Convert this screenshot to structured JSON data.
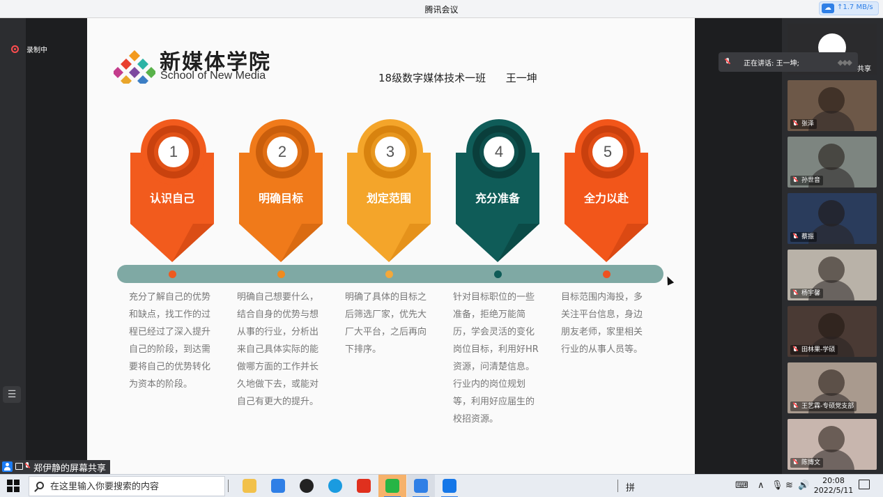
{
  "window": {
    "title": "腾讯会议",
    "net_rate": "↑1.7 MB/s"
  },
  "recording": {
    "label": "录制中"
  },
  "slide": {
    "brand_cn": "新媒体学院",
    "brand_en": "School of New Media",
    "student": "18级数字媒体技术一班      王一坤",
    "steps": [
      {
        "num": "1",
        "label": "认识自己",
        "color": "#f25b1d",
        "dark": "#c9420e",
        "desc": "充分了解自己的优势和缺点，找工作的过程已经过了深入提升自己的阶段，到达需要将自己的优势转化为资本的阶段。"
      },
      {
        "num": "2",
        "label": "明确目标",
        "color": "#f07a1a",
        "dark": "#c95e0c",
        "desc": "明确自己想要什么，结合自身的优势与想从事的行业，分析出来自己具体实际的能做哪方面的工作并长久地做下去，或能对自己有更大的提升。"
      },
      {
        "num": "3",
        "label": "划定范围",
        "color": "#f4a52a",
        "dark": "#d8830f",
        "desc": "明确了具体的目标之后筛选厂家，优先大厂大平台，之后再向下排序。"
      },
      {
        "num": "4",
        "label": "充分准备",
        "color": "#0f5c58",
        "dark": "#0a3e3b",
        "desc": "针对目标职位的一些准备，拒绝万能简历，学会灵活的变化岗位目标，利用好HR资源，问清楚信息。\n行业内的岗位规划等，利用好应届生的校招资源。"
      },
      {
        "num": "5",
        "label": "全力以赴",
        "color": "#f2561a",
        "dark": "#c9400e",
        "desc": "目标范围内海投，多关注平台信息，身边朋友老师，家里相关行业的从事人员等。"
      }
    ],
    "dot_colors": [
      "#ee5a1f",
      "#f08a1e",
      "#f4a83a",
      "#0f5c58",
      "#ee5121"
    ]
  },
  "speaking": {
    "text": "正在讲话: 王一坤;",
    "share_suffix": "共享"
  },
  "participants": [
    {
      "name": "",
      "bg": "#2b2b2d"
    },
    {
      "name": "张泽",
      "bg": "#6d5848"
    },
    {
      "name": "孙世音",
      "bg": "#7d8580"
    },
    {
      "name": "蔡振",
      "bg": "#2a3c5c"
    },
    {
      "name": "杨宇馨",
      "bg": "#b9b2a8"
    },
    {
      "name": "田林果-学硕",
      "bg": "#4a3a34"
    },
    {
      "name": "王艺霖-专硕党支部",
      "bg": "#a99a8e"
    },
    {
      "name": "陈博文",
      "bg": "#c8b6ae"
    }
  ],
  "sharer": {
    "label": "郑伊静的屏幕共享"
  },
  "taskbar": {
    "search_placeholder": "在这里输入你要搜索的内容",
    "apps": [
      {
        "name": "file-explorer-icon",
        "color": "#f2c14b"
      },
      {
        "name": "mail-icon",
        "color": "#2f7fe6"
      },
      {
        "name": "dell-icon",
        "color": "#222222"
      },
      {
        "name": "edge-icon",
        "color": "#1a9be0"
      },
      {
        "name": "wps-icon",
        "color": "#e0301e"
      },
      {
        "name": "wechat-icon",
        "color": "#26b545"
      },
      {
        "name": "tencent-meeting-icon",
        "color": "#2f7fe6"
      },
      {
        "name": "tencent-meeting-alt-icon",
        "color": "#1577e8"
      }
    ],
    "ime": "拼",
    "time": "20:08",
    "date": "2022/5/11"
  }
}
